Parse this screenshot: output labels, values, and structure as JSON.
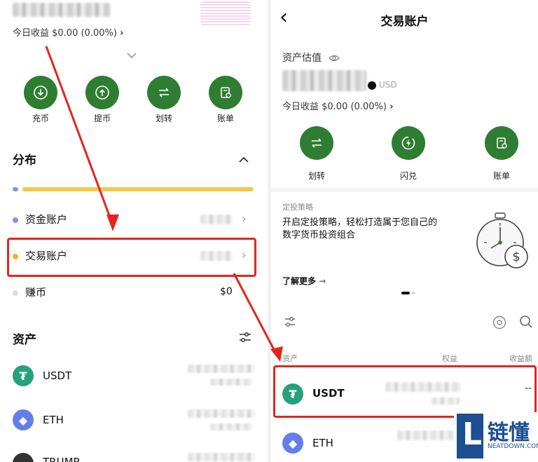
{
  "left": {
    "today_pnl": "今日收益 $0.00 (0.00%)",
    "today_pnl_chevron": "›",
    "actions": [
      {
        "label": "充币",
        "icon": "download-icon"
      },
      {
        "label": "提币",
        "icon": "upload-icon"
      },
      {
        "label": "划转",
        "icon": "transfer-icon"
      },
      {
        "label": "账单",
        "icon": "bill-icon"
      }
    ],
    "distribution_title": "分布",
    "accounts": [
      {
        "label": "资金账户",
        "dot_color": "#8a8fe8"
      },
      {
        "label": "交易账户",
        "dot_color": "#f2b01e"
      },
      {
        "label": "赚币",
        "dot_color": "#dddddd",
        "value": "$0"
      }
    ],
    "assets_title": "资产",
    "assets": [
      {
        "name": "USDT",
        "color": "#26a17b"
      },
      {
        "name": "ETH",
        "color": "#627eea"
      },
      {
        "name": "TRUMP",
        "color": "#333333"
      }
    ],
    "colors": {
      "accent_green": "#2e7d32",
      "bar_yellow": "#f2c94c",
      "bar_purple": "#8a8fe8"
    }
  },
  "right": {
    "back": "‹",
    "title": "交易账户",
    "asset_estimate": "资产估值",
    "currency": "USD",
    "today_pnl": "今日收益 $0.00 (0.00%)",
    "today_pnl_chevron": "›",
    "actions": [
      {
        "label": "划转",
        "icon": "transfer-icon"
      },
      {
        "label": "闪兑",
        "icon": "flash-swap-icon"
      },
      {
        "label": "账单",
        "icon": "bill-icon"
      }
    ],
    "promo_tag": "定投策略",
    "promo_text_line1": "开启定投策略，轻松打造属于您自己的",
    "promo_text_line2": "数字货币投资组合",
    "learn_more": "了解更多",
    "learn_more_arrow": "→",
    "table_headers": {
      "asset": "资产",
      "equity": "权益",
      "pnl": "收益额"
    },
    "assets": [
      {
        "name": "USDT",
        "color": "#26a17b",
        "pnl": "--"
      },
      {
        "name": "ETH",
        "color": "#627eea"
      }
    ]
  },
  "watermark": {
    "brand": "链懂",
    "site": "NEATDOWN.COM",
    "letter": "L"
  },
  "highlight_color": "#e3261c"
}
